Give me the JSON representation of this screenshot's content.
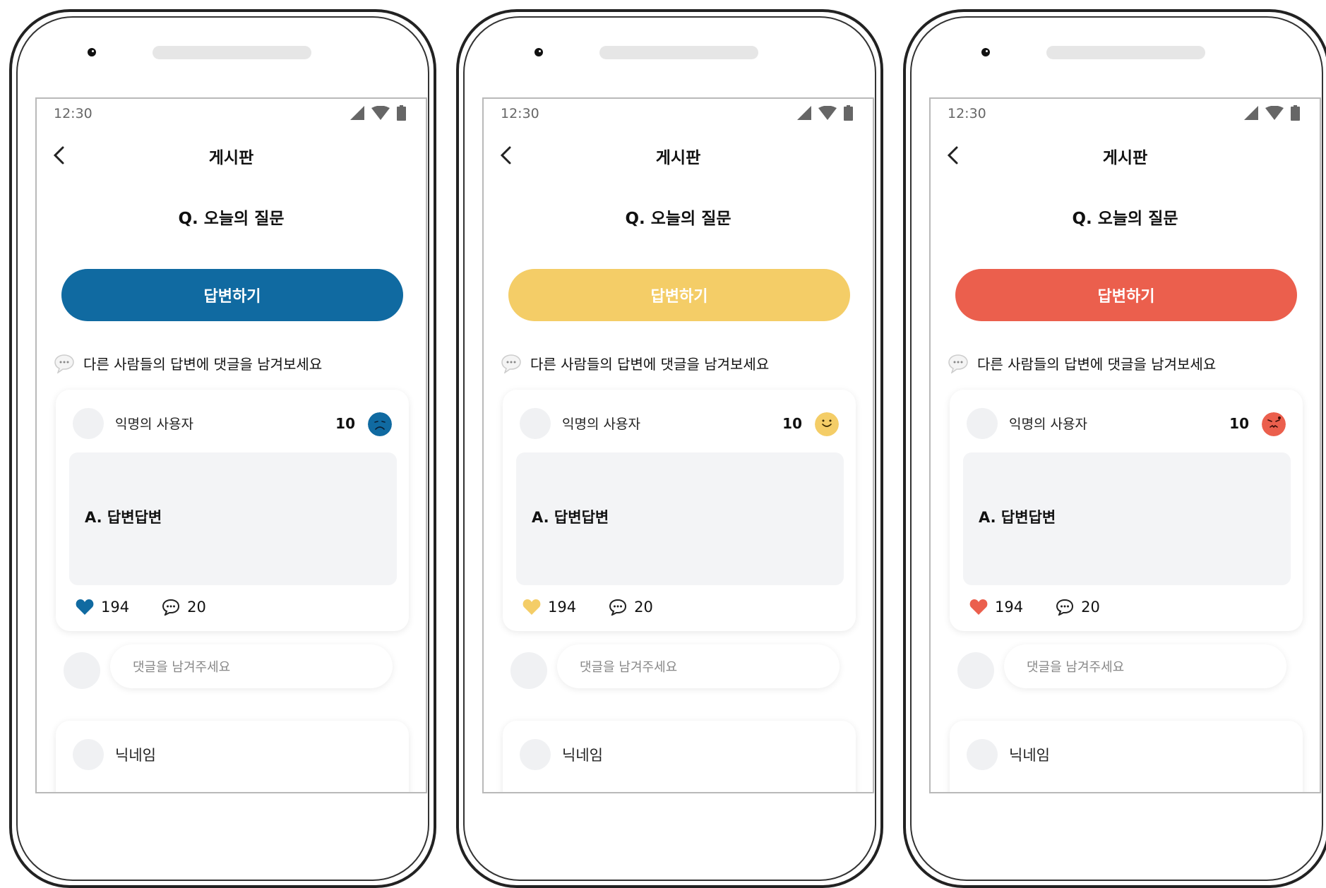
{
  "phones": [
    {
      "theme": "blue",
      "accent": "#106aa1",
      "status_time": "12:30",
      "header_title": "게시판",
      "question": "Q. 오늘의 질문",
      "answer_button": "답변하기",
      "hint": "다른 사람들의 답변에 댓글을 남겨보세요",
      "post": {
        "user": "익명의 사용자",
        "score": "10",
        "mood": "sad-face-icon",
        "answer": "A. 답변답변",
        "likes": "194",
        "comments": "20"
      },
      "comment_placeholder": "댓글을 남겨주세요",
      "next_user": "닉네임"
    },
    {
      "theme": "yellow",
      "accent": "#f4cd67",
      "status_time": "12:30",
      "header_title": "게시판",
      "question": "Q. 오늘의 질문",
      "answer_button": "답변하기",
      "hint": "다른 사람들의 답변에 댓글을 남겨보세요",
      "post": {
        "user": "익명의 사용자",
        "score": "10",
        "mood": "smile-face-icon",
        "answer": "A. 답변답변",
        "likes": "194",
        "comments": "20"
      },
      "comment_placeholder": "댓글을 남겨주세요",
      "next_user": "닉네임"
    },
    {
      "theme": "red",
      "accent": "#eb5f4d",
      "status_time": "12:30",
      "header_title": "게시판",
      "question": "Q. 오늘의 질문",
      "answer_button": "답변하기",
      "hint": "다른 사람들의 답변에 댓글을 남겨보세요",
      "post": {
        "user": "익명의 사용자",
        "score": "10",
        "mood": "angry-face-icon",
        "answer": "A. 답변답변",
        "likes": "194",
        "comments": "20"
      },
      "comment_placeholder": "댓글을 남겨주세요",
      "next_user": "닉네임"
    }
  ]
}
